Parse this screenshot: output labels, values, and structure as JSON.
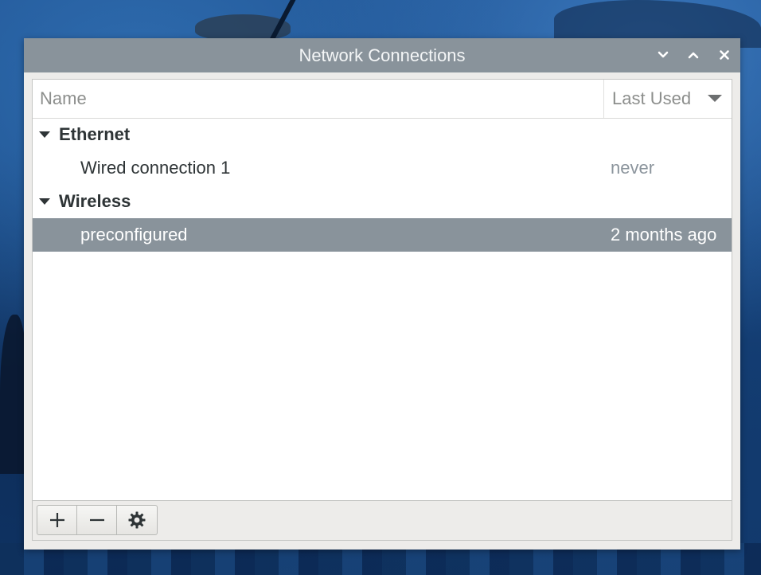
{
  "window": {
    "title": "Network Connections"
  },
  "window_controls": {
    "minimize_icon": "chevron-down-icon",
    "maximize_icon": "chevron-up-icon",
    "close_icon": "close-icon"
  },
  "table": {
    "columns": {
      "name": "Name",
      "last_used": "Last Used"
    },
    "groups": [
      {
        "label": "Ethernet",
        "connections": [
          {
            "name": "Wired connection 1",
            "last_used": "never"
          }
        ]
      },
      {
        "label": "Wireless",
        "connections": [
          {
            "name": "preconfigured",
            "last_used": "2 months ago",
            "selected": true
          }
        ]
      }
    ]
  },
  "toolbar": {
    "add_icon": "plus-icon",
    "remove_icon": "minus-icon",
    "settings_icon": "gear-icon"
  },
  "colors": {
    "titlebar": "#89939b",
    "selection": "#89939b",
    "muted_text": "#8b949c"
  }
}
